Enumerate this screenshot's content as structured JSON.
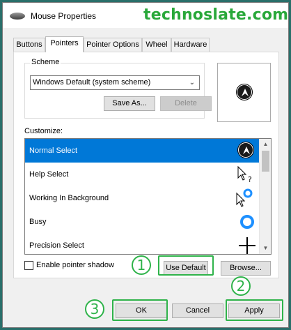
{
  "window": {
    "title": "Mouse Properties"
  },
  "watermark": "technoslate.com",
  "tabs": [
    {
      "label": "Buttons"
    },
    {
      "label": "Pointers"
    },
    {
      "label": "Pointer Options"
    },
    {
      "label": "Wheel"
    },
    {
      "label": "Hardware"
    }
  ],
  "active_tab": "Pointers",
  "scheme": {
    "label": "Scheme",
    "selected": "Windows Default (system scheme)",
    "save_as": "Save As...",
    "delete": "Delete"
  },
  "customize": {
    "label": "Customize:",
    "items": [
      {
        "label": "Normal Select",
        "icon": "arrow-cursor-icon"
      },
      {
        "label": "Help Select",
        "icon": "help-cursor-icon"
      },
      {
        "label": "Working In Background",
        "icon": "working-cursor-icon"
      },
      {
        "label": "Busy",
        "icon": "busy-cursor-icon"
      },
      {
        "label": "Precision Select",
        "icon": "crosshair-cursor-icon"
      }
    ],
    "selected_index": 0
  },
  "enable_shadow": {
    "label": "Enable pointer shadow",
    "checked": false
  },
  "buttons": {
    "use_default": "Use Default",
    "browse": "Browse...",
    "ok": "OK",
    "cancel": "Cancel",
    "apply": "Apply"
  },
  "annotations": [
    "1",
    "2",
    "3"
  ],
  "colors": {
    "accent": "#0078d7",
    "annotation": "#2fb34a",
    "watermark": "#29a83a"
  }
}
